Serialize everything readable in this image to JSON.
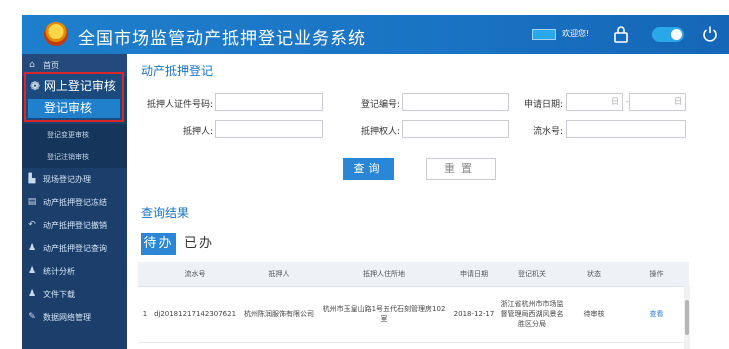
{
  "header": {
    "title": "全国市场监管动产抵押登记业务系统",
    "user": "欢迎您!"
  },
  "sidebar": {
    "home": "首页",
    "group_title": "网上登记审核",
    "group_selected": "登记审核",
    "sub_items": [
      "登记变更审核",
      "登记注销审核"
    ],
    "items": [
      "现场登记办理",
      "动产抵押登记冻结",
      "动产抵押登记撤销",
      "动产抵押登记查询",
      "统计分析",
      "文件下载",
      "数据网络管理"
    ]
  },
  "form": {
    "title": "动产抵押登记",
    "cert_label": "抵押人证件号码:",
    "regno_label": "登记编号:",
    "apply_date_label": "申请日期:",
    "mortgagor_label": "抵押人:",
    "mortgagee_label": "抵押权人:",
    "serial_label": "流水号:",
    "date_from_placeholder": "日",
    "date_sep": "-",
    "date_to_placeholder": "日",
    "query_button": "查询",
    "reset_button": "重置"
  },
  "results": {
    "title": "查询结果",
    "tab_todo": "待办",
    "tab_done": "已办",
    "columns": [
      "",
      "流水号",
      "抵押人",
      "抵押人住所地",
      "申请日期",
      "登记机关",
      "状态",
      "操作"
    ],
    "rows": [
      {
        "index": "1",
        "serial": "dj20181217142307621",
        "mortgagor": "杭州陈润服饰有限公司",
        "address": "杭州市玉皇山路1号五代石刻管理房102室",
        "date": "2018-12-17",
        "authority": "浙江省杭州市市场监督管理局西湖风景名胜区分局",
        "status": "待审核",
        "action": "查看"
      }
    ]
  }
}
